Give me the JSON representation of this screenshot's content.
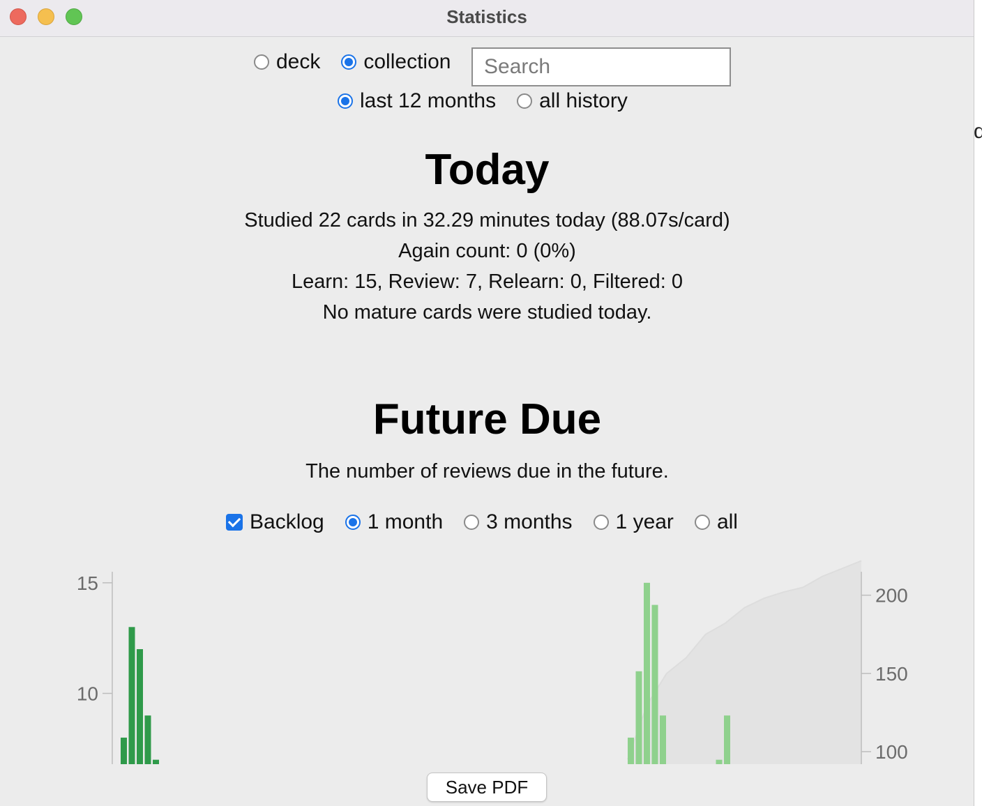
{
  "window": {
    "title": "Statistics"
  },
  "scope": {
    "deck_label": "deck",
    "collection_label": "collection",
    "selected": "collection",
    "search_placeholder": "Search"
  },
  "range": {
    "last12_label": "last 12 months",
    "all_label": "all history",
    "selected": "last 12 months"
  },
  "today": {
    "heading": "Today",
    "lines": [
      "Studied 22 cards in 32.29 minutes today (88.07s/card)",
      "Again count: 0 (0%)",
      "Learn: 15, Review: 7, Relearn: 0, Filtered: 0",
      "No mature cards were studied today."
    ]
  },
  "future_due": {
    "heading": "Future Due",
    "description": "The number of reviews due in the future.",
    "backlog_label": "Backlog",
    "backlog_checked": true,
    "periods": [
      "1 month",
      "3 months",
      "1 year",
      "all"
    ],
    "selected_period": "1 month"
  },
  "chart_data": {
    "type": "bar",
    "left_axis_ticks": [
      "15",
      "10"
    ],
    "right_axis_ticks": [
      "200",
      "150",
      "100"
    ],
    "colors": {
      "backlog": "#2f9a4a",
      "due": "#8fd18d",
      "cumulative": "#dddddd",
      "axis": "#bdbdbd",
      "tick_text": "#6b6b6b"
    },
    "backlog_series": {
      "name": "",
      "values": [
        8,
        13,
        12,
        9,
        7
      ]
    },
    "due_series": {
      "name": "",
      "values": [
        8,
        11,
        15,
        14,
        9,
        0,
        0,
        0,
        0,
        0,
        0,
        7,
        9
      ]
    },
    "cumulative_series": {
      "name": "",
      "values": [
        95,
        130,
        150,
        160,
        175,
        182,
        192,
        198,
        202,
        205,
        212,
        217,
        222
      ]
    },
    "left_ylim": [
      6.8,
      15.5
    ],
    "right_ylim": [
      92,
      215
    ]
  },
  "footer": {
    "save_pdf_label": "Save PDF"
  }
}
